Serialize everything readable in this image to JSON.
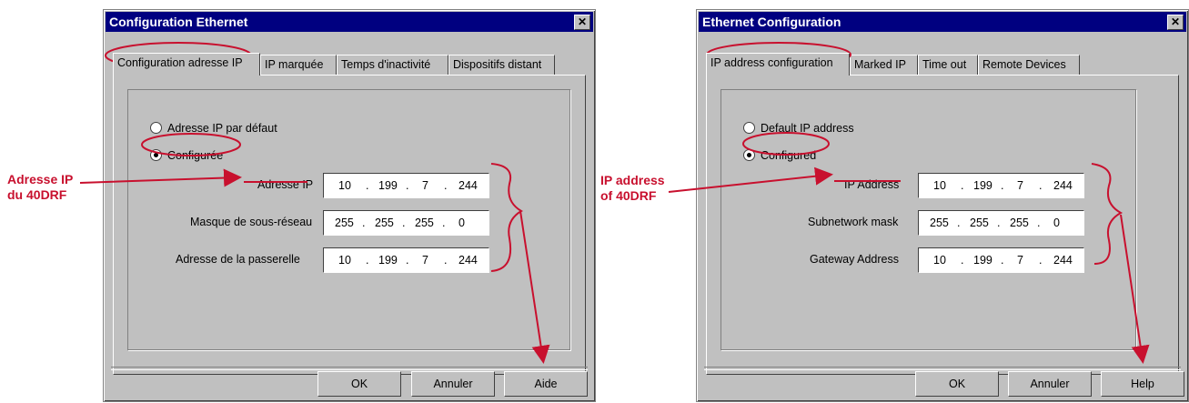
{
  "french": {
    "title": "Configuration Ethernet",
    "close_glyph": "✕",
    "tabs": [
      "Configuration adresse IP",
      "IP marquée",
      "Temps d'inactivité",
      "Dispositifs distant"
    ],
    "radio_default": "Adresse IP par défaut",
    "radio_configured": "Configurée",
    "fields": [
      {
        "label": "Adresse IP",
        "octets": [
          "10",
          "199",
          "7",
          "244"
        ]
      },
      {
        "label": "Masque de sous-réseau",
        "octets": [
          "255",
          "255",
          "255",
          "0"
        ]
      },
      {
        "label": "Adresse de la passerelle",
        "octets": [
          "10",
          "199",
          "7",
          "244"
        ]
      }
    ],
    "buttons": {
      "ok": "OK",
      "cancel": "Annuler",
      "help": "Aide"
    },
    "annotation": [
      "Adresse IP",
      "du 40DRF"
    ]
  },
  "english": {
    "title": "Ethernet Configuration",
    "close_glyph": "✕",
    "tabs": [
      "IP address configuration",
      "Marked IP",
      "Time out",
      "Remote Devices"
    ],
    "radio_default": "Default IP address",
    "radio_configured": "Configured",
    "fields": [
      {
        "label": "IP Address",
        "octets": [
          "10",
          "199",
          "7",
          "244"
        ]
      },
      {
        "label": "Subnetwork mask",
        "octets": [
          "255",
          "255",
          "255",
          "0"
        ]
      },
      {
        "label": "Gateway Address",
        "octets": [
          "10",
          "199",
          "7",
          "244"
        ]
      }
    ],
    "buttons": {
      "ok": "OK",
      "cancel": "Annuler",
      "help": "Help"
    },
    "annotation": [
      "IP address",
      "of 40DRF"
    ]
  },
  "colors": {
    "titlebar": "#000080",
    "dialog": "#c0c0c0",
    "annotation": "#c8102e"
  }
}
